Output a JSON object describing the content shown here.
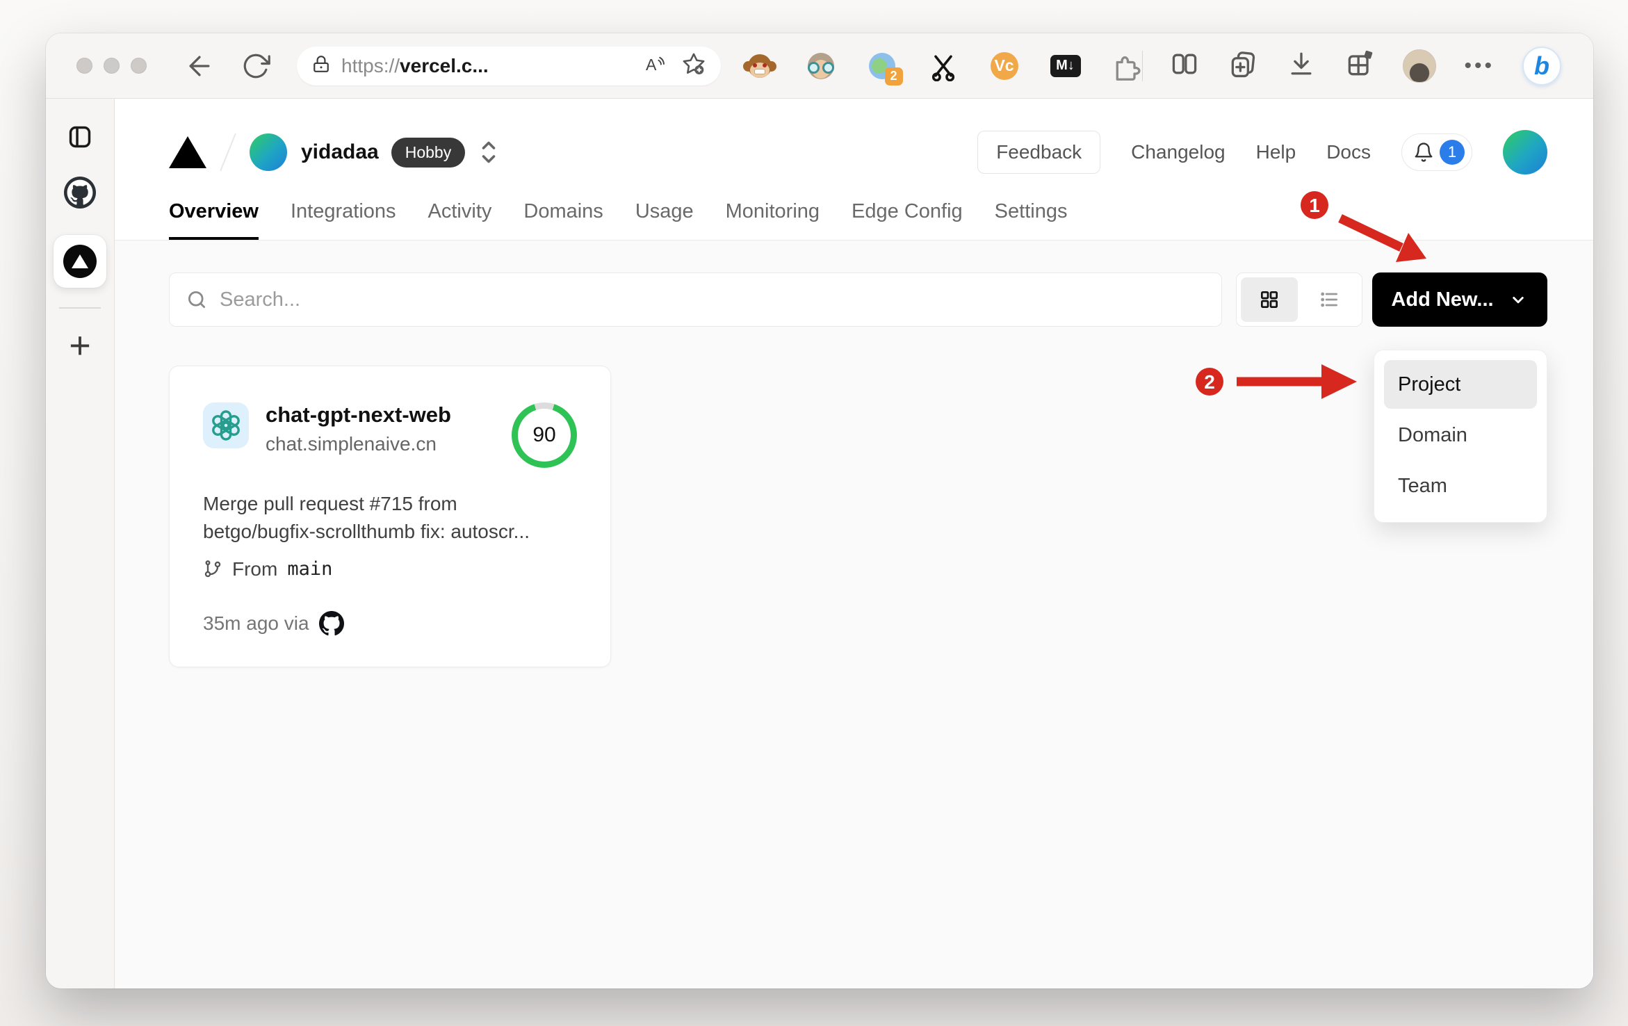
{
  "colors": {
    "annotation_red": "#d6281e",
    "score_green": "#2fc356",
    "notification_blue": "#2b7de9",
    "button_black": "#000000",
    "content_bg": "#fafafa"
  },
  "browser": {
    "url": {
      "scheme": "https://",
      "host": "vercel.c..."
    },
    "extensions": {
      "translate_badge": "2",
      "vc_label": "Vc",
      "markdown_label": "M↓"
    },
    "more_label": "•••",
    "bing_label": "b",
    "new_tab_label": "+"
  },
  "vercel": {
    "team": {
      "name": "yidadaa",
      "plan": "Hobby"
    },
    "nav": [
      "Overview",
      "Integrations",
      "Activity",
      "Domains",
      "Usage",
      "Monitoring",
      "Edge Config",
      "Settings"
    ],
    "links": {
      "feedback": "Feedback",
      "changelog": "Changelog",
      "help": "Help",
      "docs": "Docs"
    },
    "bell_count": "1",
    "search": {
      "placeholder": "Search..."
    },
    "add_new": {
      "label": "Add New..."
    },
    "dropdown": {
      "items": [
        "Project",
        "Domain",
        "Team"
      ]
    },
    "card": {
      "name": "chat-gpt-next-web",
      "domain": "chat.simplenaive.cn",
      "score": "90",
      "commit_line1": "Merge pull request #715 from",
      "commit_line2": "betgo/bugfix-scrollthumb fix: autoscr...",
      "from_label": "From",
      "branch": "main",
      "meta": "35m ago via"
    },
    "annotations": {
      "step1": "1",
      "step2": "2"
    }
  }
}
